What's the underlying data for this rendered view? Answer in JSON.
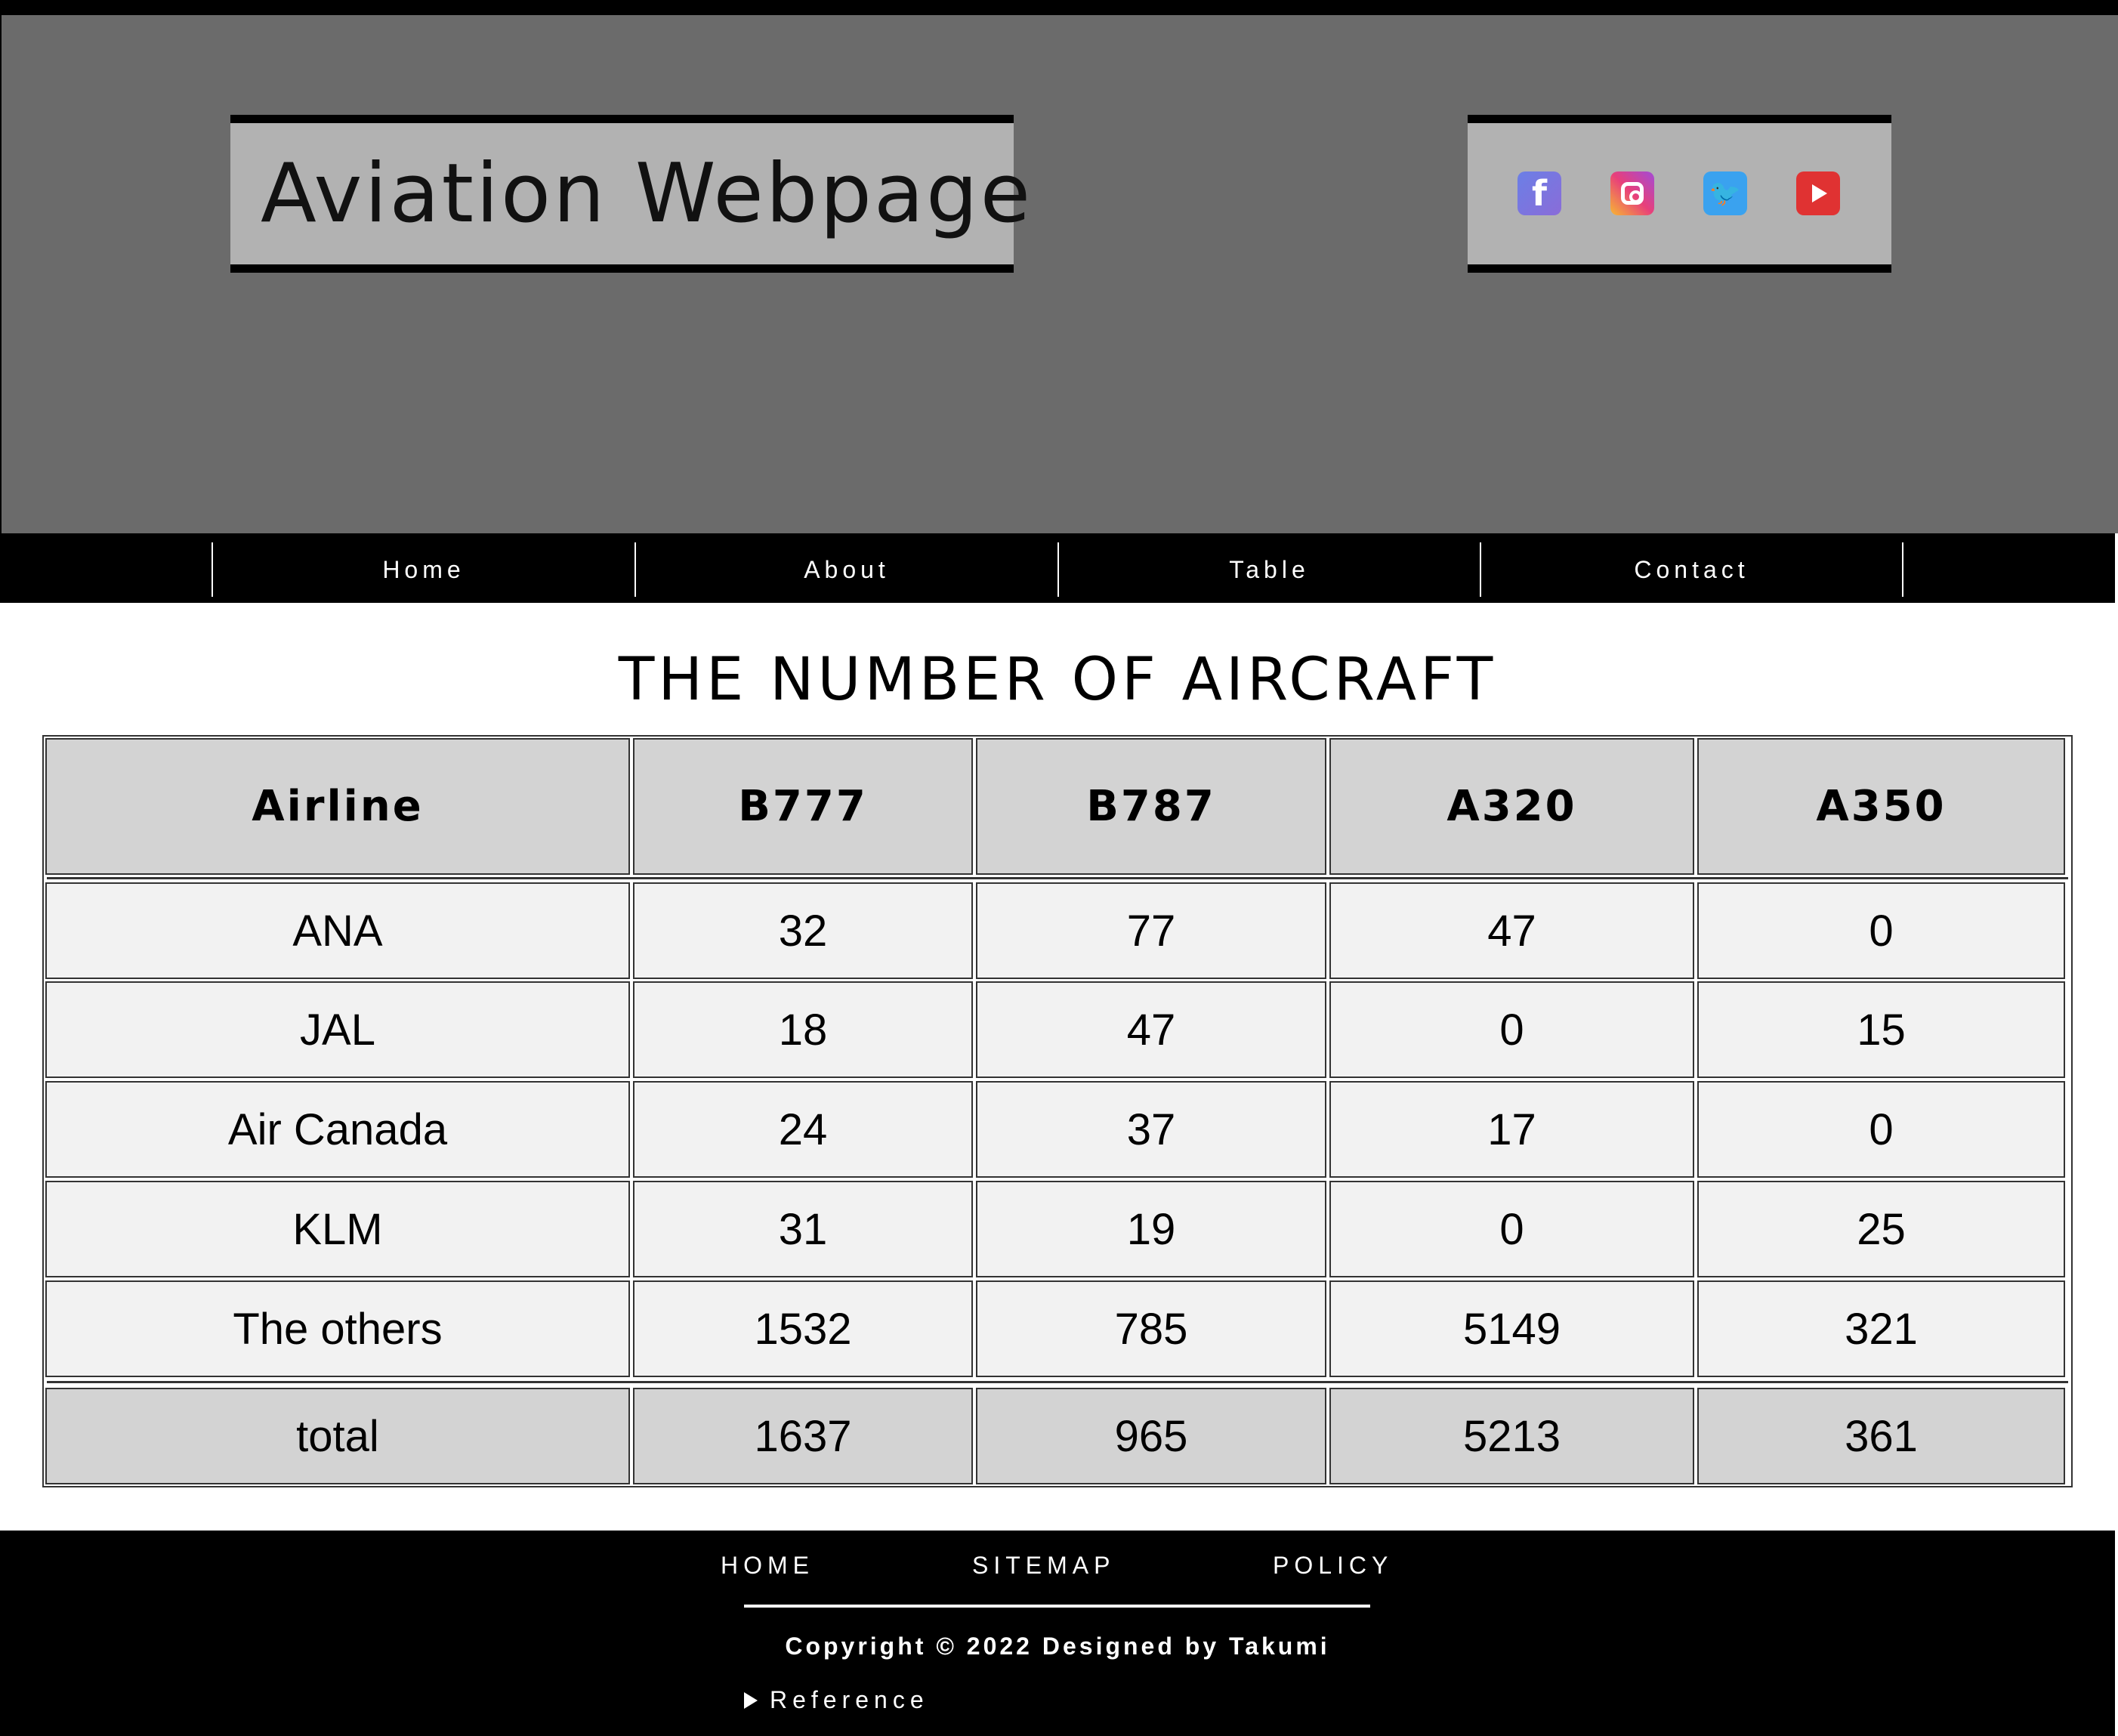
{
  "header": {
    "title": "Aviation Webpage",
    "social": [
      {
        "name": "facebook-icon",
        "glyph": "f",
        "color": "#7a76e0"
      },
      {
        "name": "instagram-icon",
        "glyph": "",
        "color": "#e8407a"
      },
      {
        "name": "twitter-icon",
        "glyph": "🐦",
        "color": "#3aa2ef"
      },
      {
        "name": "youtube-icon",
        "glyph": "",
        "color": "#e03232"
      }
    ]
  },
  "nav": {
    "items": [
      {
        "label": "Home"
      },
      {
        "label": "About"
      },
      {
        "label": "Table"
      },
      {
        "label": "Contact"
      }
    ]
  },
  "main": {
    "heading": "THE NUMBER OF AIRCRAFT",
    "table": {
      "headers": [
        "Airline",
        "B777",
        "B787",
        "A320",
        "A350"
      ],
      "rows": [
        [
          "ANA",
          "32",
          "77",
          "47",
          "0"
        ],
        [
          "JAL",
          "18",
          "47",
          "0",
          "15"
        ],
        [
          "Air Canada",
          "24",
          "37",
          "17",
          "0"
        ],
        [
          "KLM",
          "31",
          "19",
          "0",
          "25"
        ],
        [
          "The others",
          "1532",
          "785",
          "5149",
          "321"
        ]
      ],
      "footer": [
        "total",
        "1637",
        "965",
        "5213",
        "361"
      ]
    }
  },
  "footer": {
    "links": [
      {
        "label": "HOME"
      },
      {
        "label": "SITEMAP"
      },
      {
        "label": "POLICY"
      }
    ],
    "copyright": "Copyright © 2022 Designed by Takumi",
    "reference_label": "Reference"
  },
  "colors": {
    "header_bg": "#6b6b6b",
    "title_box_bg": "#b2b2b2",
    "nav_bg": "#000000",
    "table_head_bg": "#d3d3d3",
    "table_body_bg": "#f2f2f2"
  }
}
